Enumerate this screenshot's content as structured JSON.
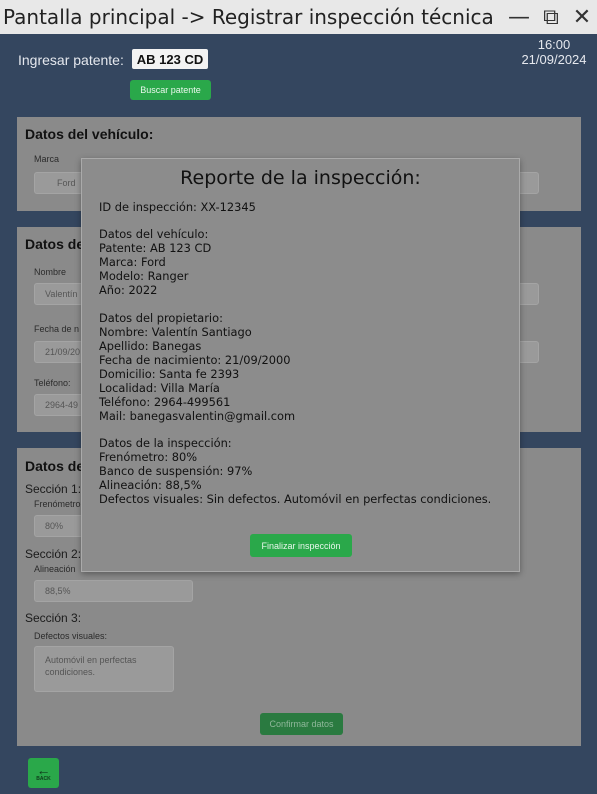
{
  "window": {
    "title": "Pantalla principal -> Registrar inspección técnica",
    "minimize_glyph": "—",
    "restore_glyph": "⧉",
    "close_glyph": "✕"
  },
  "header": {
    "patente_label": "Ingresar patente:",
    "patente_value": "AB 123 CD",
    "search_button": "Buscar patente",
    "time": "16:00",
    "date": "21/09/2024"
  },
  "vehicle_panel": {
    "title": "Datos del vehículo:",
    "marca_label": "Marca",
    "marca_value": "Ford"
  },
  "owner_panel": {
    "title": "Datos de",
    "nombre_label": "Nombre",
    "nombre_value": "Valentín",
    "fecha_label": "Fecha de n",
    "fecha_value": "21/09/20",
    "telefono_label": "Teléfono:",
    "telefono_value": "2964-49"
  },
  "inspection_panel": {
    "title": "Datos de",
    "s1_title": "Sección 1:",
    "s1_label": "Frenómetro",
    "s1_value": "80%",
    "s2_title": "Sección 2:",
    "s2_label": "Alineación",
    "s2_value": "88,5%",
    "s3_title": "Sección 3:",
    "s3_label": "Defectos visuales:",
    "s3_value": "Automóvil en perfectas condiciones.",
    "confirm_button": "Confirmar datos"
  },
  "back_button": {
    "label": "BACK",
    "icon": "back-arrow-icon"
  },
  "modal": {
    "title": "Reporte de la inspección:",
    "lines": [
      "ID de inspección: XX-12345",
      "Datos del vehículo:",
      "Patente: AB 123 CD",
      "Marca: Ford",
      "Modelo: Ranger",
      "Año: 2022",
      "Datos del propietario:",
      "Nombre: Valentín Santiago",
      "Apellido: Banegas",
      "Fecha de nacimiento: 21/09/2000",
      "Domicilio: Santa fe 2393",
      "Localidad: Villa María",
      "Teléfono: 2964-499561",
      "Mail: banegasvalentin@gmail.com",
      "Datos de la inspección:",
      "Frenómetro: 80%",
      "Banco de suspensión: 97%",
      "Alineación: 88,5%",
      "Defectos visuales: Sin defectos. Automóvil en perfectas condiciones."
    ],
    "finalize_button": "Finalizar inspección"
  },
  "colors": {
    "background": "#2d3e5c",
    "panel": "#8a8a8a",
    "accent_green": "#2aa84a"
  }
}
